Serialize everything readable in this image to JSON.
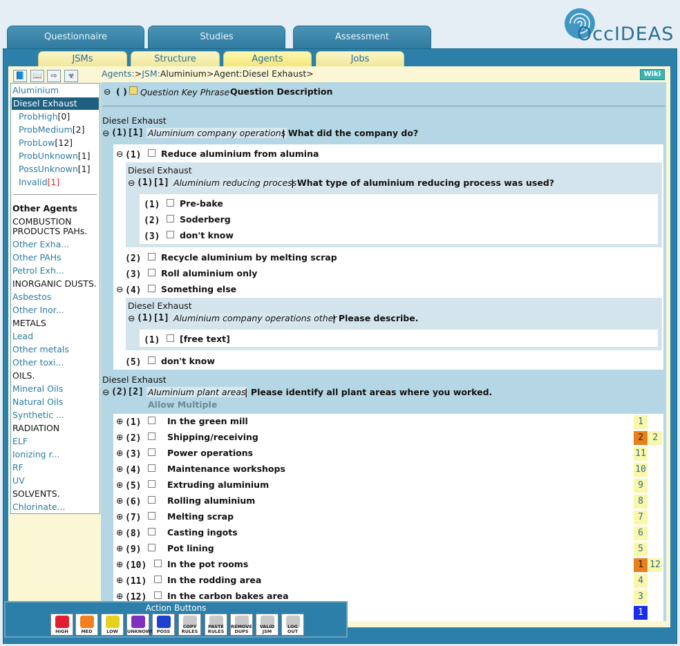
{
  "logo": {
    "text": "OccIDEAS"
  },
  "main_tabs": [
    {
      "label": "Questionnaire"
    },
    {
      "label": "Studies"
    },
    {
      "label": "Assessment"
    }
  ],
  "sub_tabs": [
    {
      "label": "JSMs"
    },
    {
      "label": "Structure"
    },
    {
      "label": "Agents"
    },
    {
      "label": "Jobs"
    }
  ],
  "toolbar_icons": [
    "book-icon",
    "open-book-icon",
    "export-icon",
    "biohazard-icon"
  ],
  "breadcrumb": {
    "agents": "Agents:",
    "sep1": ">",
    "jsm": "JSM:",
    "jsm_name": "Aluminium",
    "sep2": ">",
    "agent": "Agent:Diesel Exhaust",
    "sep3": ">"
  },
  "wiki_label": "Wiki",
  "sidebar": {
    "items": [
      {
        "label": "Aluminium"
      },
      {
        "label": "Diesel Exhaust"
      },
      {
        "label": "ProbHigh",
        "count": "[0]"
      },
      {
        "label": "ProbMedium",
        "count": "[2]"
      },
      {
        "label": "ProbLow",
        "count": "[12]"
      },
      {
        "label": "ProbUnknown",
        "count": "[1]"
      },
      {
        "label": "PossUnknown",
        "count": "[1]"
      },
      {
        "label": "Invalid",
        "count": "[1]"
      },
      {
        "label": "Other Agents"
      },
      {
        "label": "COMBUSTION"
      },
      {
        "label": "PRODUCTS PAHs."
      },
      {
        "label": "Other Exha..."
      },
      {
        "label": "Other PAHs"
      },
      {
        "label": "Petrol Exh..."
      },
      {
        "label": "INORGANIC DUSTS."
      },
      {
        "label": "Asbestos"
      },
      {
        "label": "Other Inor..."
      },
      {
        "label": "METALS"
      },
      {
        "label": "Lead"
      },
      {
        "label": "Other metals"
      },
      {
        "label": "Other toxi..."
      },
      {
        "label": "OILS."
      },
      {
        "label": "Mineral Oils"
      },
      {
        "label": "Natural Oils"
      },
      {
        "label": "Synthetic ..."
      },
      {
        "label": "RADIATION"
      },
      {
        "label": "ELF"
      },
      {
        "label": "Ionizing r..."
      },
      {
        "label": "RF"
      },
      {
        "label": "UV"
      },
      {
        "label": "SOLVENTS."
      },
      {
        "label": "Chlorinate..."
      }
    ]
  },
  "header_row": {
    "expand": "⊖",
    "parens": "( )",
    "key_phrase": "Question Key Phrase",
    "description": "Question Description"
  },
  "q1": {
    "agent": "Diesel Exhaust",
    "num": "(1)[1]",
    "key_phrase": "Aluminium company operations",
    "text": "| What did the company do?",
    "answers": [
      {
        "num": "(1)",
        "text": "Reduce aluminium from alumina"
      },
      {
        "num": "(2)",
        "text": "Recycle aluminium by melting scrap"
      },
      {
        "num": "(3)",
        "text": "Roll aluminium only"
      },
      {
        "num": "(4)",
        "text": "Something else"
      },
      {
        "num": "(5)",
        "text": "don't know"
      }
    ],
    "sub1": {
      "agent": "Diesel Exhaust",
      "num": "(1)[1]",
      "key_phrase": "Aluminium reducing process",
      "text": "| What type of aluminium reducing process was used?",
      "answers": [
        {
          "num": "(1)",
          "text": "Pre-bake"
        },
        {
          "num": "(2)",
          "text": "Soderberg"
        },
        {
          "num": "(3)",
          "text": "don't know"
        }
      ]
    },
    "sub4": {
      "agent": "Diesel Exhaust",
      "num": "(1)[1]",
      "key_phrase": "Aluminium company operations other",
      "text": "| Please describe.",
      "answers": [
        {
          "num": "(1)",
          "text": "[free text]"
        }
      ]
    }
  },
  "q2": {
    "agent": "Diesel Exhaust",
    "num": "(2)[2]",
    "key_phrase": "Aluminium plant areas",
    "text": "| Please identify all plant areas where you worked.",
    "allow_multiple": "Allow Multiple",
    "answers": [
      {
        "num": "(1)",
        "text": "In the green mill",
        "rule1": "1",
        "rule2": ""
      },
      {
        "num": "(2)",
        "text": "Shipping/receiving",
        "rule1": "2",
        "rule2": "2"
      },
      {
        "num": "(3)",
        "text": "Power operations",
        "rule1": "11",
        "rule2": ""
      },
      {
        "num": "(4)",
        "text": "Maintenance workshops",
        "rule1": "10",
        "rule2": ""
      },
      {
        "num": "(5)",
        "text": "Extruding aluminium",
        "rule1": "9",
        "rule2": ""
      },
      {
        "num": "(6)",
        "text": "Rolling aluminium",
        "rule1": "8",
        "rule2": ""
      },
      {
        "num": "(7)",
        "text": "Melting scrap",
        "rule1": "7",
        "rule2": ""
      },
      {
        "num": "(8)",
        "text": "Casting ingots",
        "rule1": "6",
        "rule2": ""
      },
      {
        "num": "(9)",
        "text": "Pot lining",
        "rule1": "5",
        "rule2": ""
      },
      {
        "num": "(10)",
        "text": "In the pot rooms",
        "rule1": "1",
        "rule2": "12"
      },
      {
        "num": "(11)",
        "text": "In the rodding area",
        "rule1": "4",
        "rule2": ""
      },
      {
        "num": "(12)",
        "text": "In the carbon bakes area",
        "rule1": "3",
        "rule2": ""
      },
      {
        "num": "",
        "text": "",
        "rule1": "1",
        "rule2": ""
      }
    ]
  },
  "action_buttons": {
    "title": "Action Buttons",
    "buttons": [
      {
        "label": "HIGH",
        "color": "#e02030"
      },
      {
        "label": "MED",
        "color": "#f08020"
      },
      {
        "label": "LOW",
        "color": "#e8d020"
      },
      {
        "label": "UNKNOWN",
        "color": "#8030c0"
      },
      {
        "label": "POSS",
        "color": "#2040d0"
      },
      {
        "label": "COPY RULES",
        "color": "#c8c8c8"
      },
      {
        "label": "PASTE RULES",
        "color": "#c8c8c8"
      },
      {
        "label": "REMOVE DUPS",
        "color": "#c8c8c8"
      },
      {
        "label": "VALID JSM",
        "color": "#c8c8c8"
      },
      {
        "label": "LOG OUT",
        "color": "#c8c8c8"
      }
    ]
  },
  "colors": {
    "frame": "#2b7fa8",
    "selected": "#1f5f82",
    "rule_yellow": "#fbf7a8",
    "rule_orange": "#e8801c",
    "rule_blue": "#1a2ee8"
  }
}
